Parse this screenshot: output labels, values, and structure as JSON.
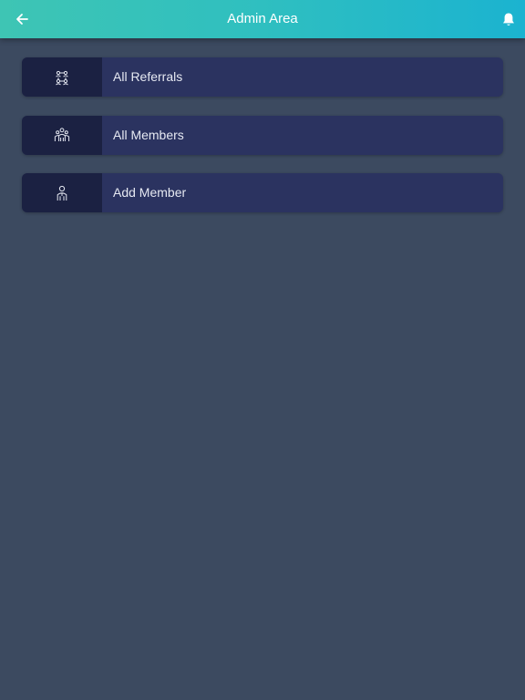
{
  "header": {
    "title": "Admin Area",
    "back_icon": "arrow-left-icon",
    "notification_icon": "bell-icon",
    "gradient_start": "#3ec5b4",
    "gradient_end": "#1bb3d0"
  },
  "menu": {
    "items": [
      {
        "label": "All Referrals",
        "icon": "network-people-icon"
      },
      {
        "label": "All Members",
        "icon": "group-people-icon"
      },
      {
        "label": "Add Member",
        "icon": "person-icon"
      }
    ]
  },
  "colors": {
    "background": "#3c4a60",
    "item_background": "#2b3360",
    "icon_box_background": "#1b2142"
  }
}
